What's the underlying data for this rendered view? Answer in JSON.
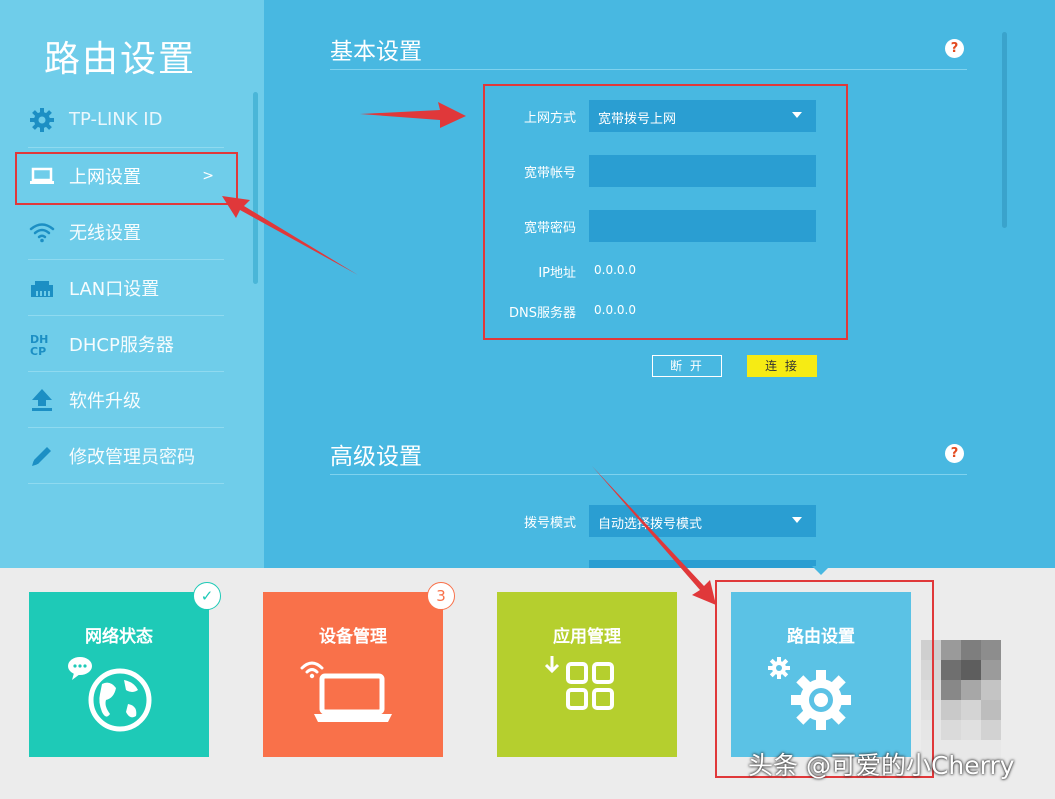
{
  "sidebar": {
    "title": "路由设置",
    "items": [
      {
        "label": "TP-LINK ID",
        "icon": "gear-icon"
      },
      {
        "label": "上网设置",
        "icon": "laptop-icon",
        "chevron": ">"
      },
      {
        "label": "无线设置",
        "icon": "wifi-icon"
      },
      {
        "label": "LAN口设置",
        "icon": "lan-port-icon"
      },
      {
        "label": "DHCP服务器",
        "icon": "dhcp-icon"
      },
      {
        "label": "软件升级",
        "icon": "upload-icon"
      },
      {
        "label": "修改管理员密码",
        "icon": "pencil-icon"
      }
    ]
  },
  "basic": {
    "title": "基本设置",
    "help": "?",
    "fields": {
      "mode_label": "上网方式",
      "mode_value": "宽带拨号上网",
      "account_label": "宽带帐号",
      "account_value": "",
      "password_label": "宽带密码",
      "password_value": "",
      "ip_label": "IP地址",
      "ip_value": "0.0.0.0",
      "dns_label": "DNS服务器",
      "dns_value": "0.0.0.0"
    },
    "buttons": {
      "disconnect": "断 开",
      "connect": "连 接"
    }
  },
  "advanced": {
    "title": "高级设置",
    "help": "?",
    "dial_label": "拨号模式",
    "dial_value": "自动选择拨号模式"
  },
  "tiles": [
    {
      "label": "网络状态",
      "color": "#1ecab7",
      "badge": "✓"
    },
    {
      "label": "设备管理",
      "color": "#f9714a",
      "badge": "3"
    },
    {
      "label": "应用管理",
      "color": "#b5cf2e"
    },
    {
      "label": "路由设置",
      "color": "#5bc2e5"
    }
  ],
  "colors": {
    "sidebar": "#6fcdea",
    "main": "#48b8e1",
    "field": "#2a9ed2",
    "connect_button": "#f6eb14",
    "annotation_red": "#e0383a"
  },
  "watermark": "头条 @可爱的小Cherry"
}
